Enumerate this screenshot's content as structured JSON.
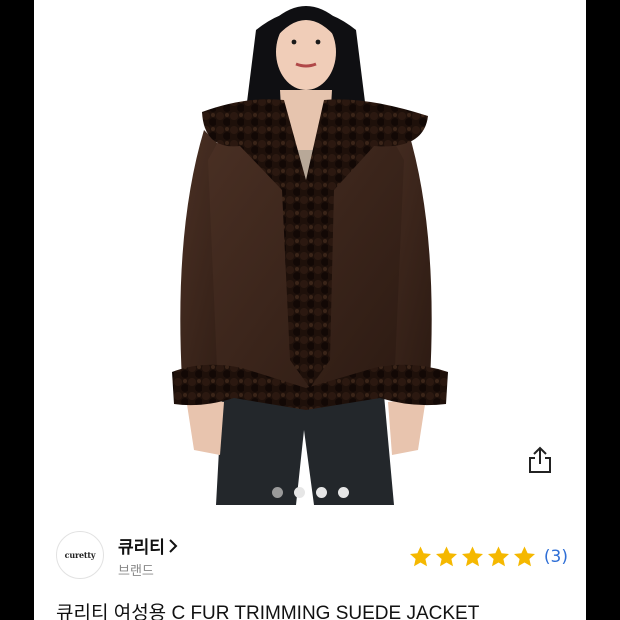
{
  "brand": {
    "logo_text": "curetty",
    "name": "큐리티",
    "sub_label": "브랜드"
  },
  "rating": {
    "stars": 5,
    "count_text": "(3)",
    "star_color": "#f5b800"
  },
  "product": {
    "title": "큐리티 여성용 C FUR TRIMMING SUEDE JACKET"
  },
  "carousel": {
    "total": 4,
    "active_index": 0
  },
  "icons": {
    "share": "share-icon",
    "chevron": "chevron-right-icon"
  }
}
